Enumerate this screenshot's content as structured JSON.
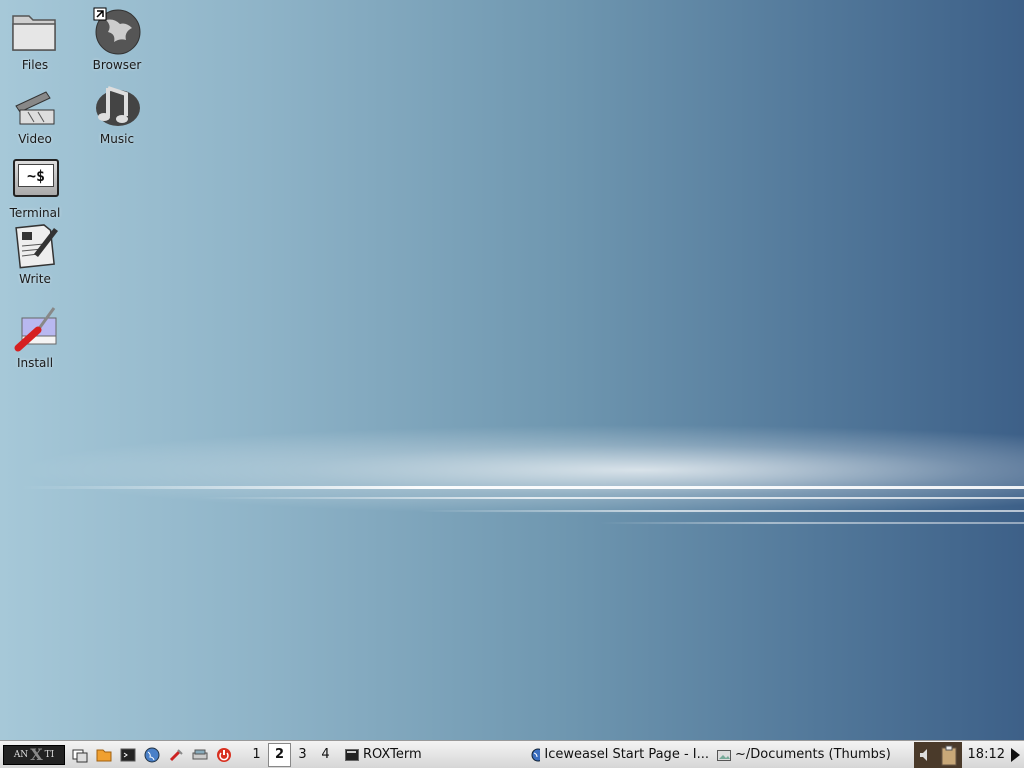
{
  "desktop": {
    "icons": [
      {
        "label": "Files",
        "icon": "folder-icon"
      },
      {
        "label": "Browser",
        "icon": "globe-icon"
      },
      {
        "label": "Video",
        "icon": "clapperboard-icon"
      },
      {
        "label": "Music",
        "icon": "music-note-icon"
      },
      {
        "label": "Terminal",
        "icon": "terminal-icon",
        "glyph": "~$"
      },
      {
        "label": "Write",
        "icon": "document-pen-icon"
      },
      {
        "label": "Install",
        "icon": "screwdriver-icon"
      }
    ]
  },
  "taskbar": {
    "menu_label_left": "AN",
    "menu_label_mid": "X",
    "menu_label_right": "TI",
    "launchers": [
      "window-icon",
      "folder-icon",
      "terminal-icon",
      "globe-icon",
      "tools-icon",
      "drive-icon",
      "power-icon"
    ],
    "workspaces": [
      "1",
      "2",
      "3",
      "4"
    ],
    "active_workspace": "2",
    "tasks": [
      {
        "label": "ROXTerm",
        "icon": "terminal-icon"
      },
      {
        "label": "Iceweasel Start Page - I...",
        "icon": "globe-icon"
      },
      {
        "label": "~/Documents (Thumbs)",
        "icon": "image-folder-icon"
      }
    ],
    "clock": "18:12"
  }
}
